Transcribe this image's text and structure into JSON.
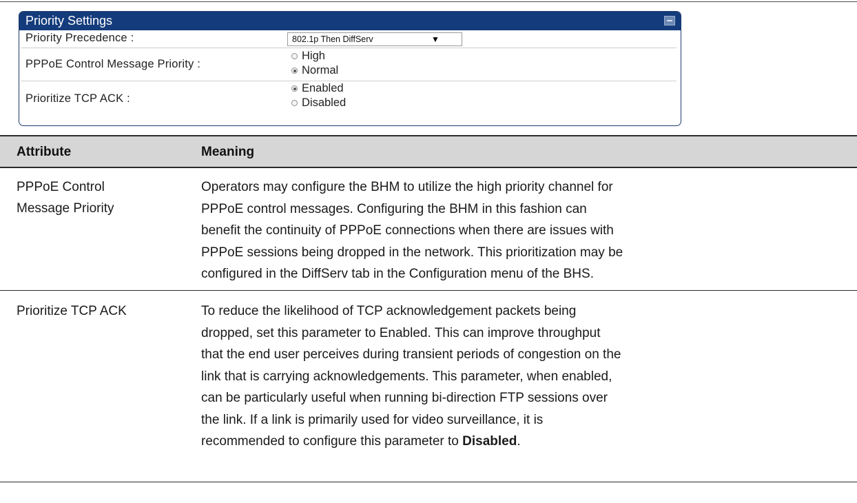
{
  "panel": {
    "title": "Priority Settings",
    "rows": {
      "precedence_label": "Priority Precedence :",
      "precedence_value": "802.1p Then DiffServ",
      "pppoe_label": "PPPoE Control Message Priority :",
      "pppoe_options": [
        "High",
        "Normal"
      ],
      "pppoe_selected": "Normal",
      "tcp_label": "Prioritize TCP ACK :",
      "tcp_options": [
        "Enabled",
        "Disabled"
      ],
      "tcp_selected": "Enabled"
    }
  },
  "table": {
    "headers": [
      "Attribute",
      "Meaning"
    ],
    "rows": [
      {
        "attribute_lines": [
          "PPPoE Control",
          "Message Priority"
        ],
        "meaning_lines": [
          "Operators may configure the BHM to utilize the high priority channel for",
          "PPPoE control messages. Configuring the BHM in this fashion can",
          "benefit the continuity of PPPoE connections when there are issues with",
          "PPPoE sessions being dropped in the network. This prioritization may be",
          "configured in the DiffServ tab in the Configuration menu of the BHS."
        ]
      },
      {
        "attribute_lines": [
          "Prioritize TCP ACK"
        ],
        "meaning_lines": [
          "To reduce the likelihood of TCP acknowledgement packets being",
          "dropped, set this parameter to Enabled. This can improve throughput",
          "that the end user perceives during transient periods of congestion on the",
          "link that is carrying acknowledgements. This parameter, when enabled,",
          "can be particularly useful when running bi-direction FTP sessions over",
          "the link. If a link is primarily used for video surveillance, it is",
          "recommended to configure this parameter to "
        ],
        "meaning_bold_tail": "Disabled",
        "meaning_tail_end": "."
      }
    ]
  }
}
